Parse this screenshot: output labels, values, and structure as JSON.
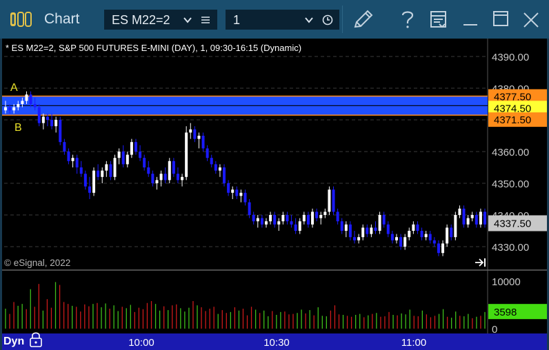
{
  "window": {
    "title": "Chart",
    "symbol": "ES M22=2",
    "interval": "1"
  },
  "chart_header": "* ES M22=2, S&P 500 FUTURES E-MINI (DAY), 1, 09:30-16:15 (Dynamic)",
  "copyright": "© eSignal, 2022",
  "annotations": {
    "top": "A",
    "bottom": "B"
  },
  "bottom_bar": {
    "mode": "Dyn"
  },
  "colors": {
    "titlebar": "#1a4e6e",
    "up_candle": "#ffffff",
    "down_candle": "#1a1aff",
    "band": "#1f4fff",
    "price_flag_orange": "#ff8c1a",
    "price_flag_yellow": "#ffff33",
    "volume_flag_green": "#44dd11",
    "last_price_flag": "#c8c8c8"
  },
  "chart_data": [
    {
      "type": "candlestick",
      "x_ticks": [
        "10:00",
        "10:30",
        "11:00"
      ],
      "y_ticks": [
        "4330.00",
        "4340.00",
        "4350.00",
        "4360.00",
        "4370.00",
        "4380.00",
        "4390.00"
      ],
      "ylim": [
        4326,
        4394
      ],
      "price_flags": [
        "4377.50",
        "4374.50",
        "4371.50"
      ],
      "last_price": "4337.50",
      "band": {
        "top": 4377.5,
        "bottom": 4371.5,
        "mid": 4374.5
      },
      "candles": [
        [
          4373,
          4376,
          4372,
          4374
        ],
        [
          4374,
          4375,
          4372,
          4373
        ],
        [
          4373,
          4375,
          4372,
          4374
        ],
        [
          4374,
          4376,
          4373,
          4375
        ],
        [
          4375,
          4377,
          4374,
          4376
        ],
        [
          4376,
          4379,
          4375,
          4378
        ],
        [
          4378,
          4379,
          4374,
          4375
        ],
        [
          4375,
          4377,
          4373,
          4374
        ],
        [
          4374,
          4375,
          4368,
          4369
        ],
        [
          4369,
          4372,
          4367,
          4371
        ],
        [
          4371,
          4372,
          4368,
          4370
        ],
        [
          4370,
          4372,
          4367,
          4368
        ],
        [
          4368,
          4371,
          4366,
          4370
        ],
        [
          4370,
          4371,
          4362,
          4363
        ],
        [
          4363,
          4364,
          4359,
          4360
        ],
        [
          4360,
          4361,
          4356,
          4357
        ],
        [
          4357,
          4359,
          4355,
          4358
        ],
        [
          4358,
          4359,
          4353,
          4355
        ],
        [
          4355,
          4357,
          4352,
          4353
        ],
        [
          4353,
          4354,
          4348,
          4349
        ],
        [
          4349,
          4352,
          4345,
          4347
        ],
        [
          4347,
          4355,
          4346,
          4354
        ],
        [
          4354,
          4356,
          4351,
          4352
        ],
        [
          4352,
          4355,
          4350,
          4354
        ],
        [
          4354,
          4357,
          4352,
          4356
        ],
        [
          4356,
          4357,
          4351,
          4352
        ],
        [
          4352,
          4359,
          4351,
          4358
        ],
        [
          4358,
          4361,
          4356,
          4360
        ],
        [
          4360,
          4362,
          4355,
          4356
        ],
        [
          4356,
          4360,
          4355,
          4359
        ],
        [
          4359,
          4364,
          4358,
          4363
        ],
        [
          4363,
          4364,
          4359,
          4360
        ],
        [
          4360,
          4362,
          4357,
          4358
        ],
        [
          4358,
          4359,
          4354,
          4355
        ],
        [
          4355,
          4357,
          4352,
          4353
        ],
        [
          4353,
          4354,
          4349,
          4350
        ],
        [
          4350,
          4352,
          4348,
          4351
        ],
        [
          4351,
          4354,
          4349,
          4353
        ],
        [
          4353,
          4355,
          4350,
          4351
        ],
        [
          4351,
          4358,
          4350,
          4357
        ],
        [
          4357,
          4358,
          4352,
          4353
        ],
        [
          4353,
          4355,
          4350,
          4351
        ],
        [
          4351,
          4353,
          4349,
          4352
        ],
        [
          4352,
          4368,
          4351,
          4366
        ],
        [
          4366,
          4369,
          4364,
          4367
        ],
        [
          4367,
          4368,
          4363,
          4364
        ],
        [
          4364,
          4366,
          4361,
          4365
        ],
        [
          4365,
          4366,
          4360,
          4361
        ],
        [
          4361,
          4362,
          4357,
          4358
        ],
        [
          4358,
          4359,
          4355,
          4356
        ],
        [
          4356,
          4357,
          4353,
          4354
        ],
        [
          4354,
          4356,
          4352,
          4355
        ],
        [
          4355,
          4356,
          4349,
          4350
        ],
        [
          4350,
          4351,
          4346,
          4347
        ],
        [
          4347,
          4349,
          4345,
          4348
        ],
        [
          4348,
          4349,
          4345,
          4346
        ],
        [
          4346,
          4348,
          4344,
          4347
        ],
        [
          4347,
          4348,
          4343,
          4344
        ],
        [
          4344,
          4345,
          4339,
          4340
        ],
        [
          4340,
          4341,
          4337,
          4338
        ],
        [
          4338,
          4340,
          4336,
          4339
        ],
        [
          4339,
          4340,
          4336,
          4337
        ],
        [
          4337,
          4339,
          4336,
          4338
        ],
        [
          4338,
          4341,
          4337,
          4340
        ],
        [
          4340,
          4341,
          4336,
          4337
        ],
        [
          4337,
          4339,
          4335,
          4338
        ],
        [
          4338,
          4341,
          4337,
          4340
        ],
        [
          4340,
          4341,
          4337,
          4338
        ],
        [
          4338,
          4340,
          4336,
          4337
        ],
        [
          4337,
          4339,
          4334,
          4335
        ],
        [
          4335,
          4339,
          4334,
          4338
        ],
        [
          4338,
          4341,
          4337,
          4340
        ],
        [
          4340,
          4341,
          4336,
          4337
        ],
        [
          4337,
          4342,
          4336,
          4341
        ],
        [
          4341,
          4342,
          4338,
          4339
        ],
        [
          4339,
          4341,
          4337,
          4340
        ],
        [
          4340,
          4342,
          4339,
          4341
        ],
        [
          4341,
          4349,
          4340,
          4348
        ],
        [
          4348,
          4349,
          4340,
          4341
        ],
        [
          4341,
          4342,
          4337,
          4338
        ],
        [
          4338,
          4339,
          4334,
          4335
        ],
        [
          4335,
          4338,
          4333,
          4337
        ],
        [
          4337,
          4338,
          4332,
          4333
        ],
        [
          4333,
          4335,
          4331,
          4332
        ],
        [
          4332,
          4334,
          4331,
          4333
        ],
        [
          4333,
          4337,
          4332,
          4336
        ],
        [
          4336,
          4337,
          4333,
          4334
        ],
        [
          4334,
          4337,
          4333,
          4336
        ],
        [
          4336,
          4338,
          4334,
          4335
        ],
        [
          4335,
          4341,
          4334,
          4340
        ],
        [
          4340,
          4341,
          4336,
          4337
        ],
        [
          4337,
          4338,
          4333,
          4334
        ],
        [
          4334,
          4335,
          4331,
          4332
        ],
        [
          4332,
          4334,
          4331,
          4333
        ],
        [
          4333,
          4334,
          4329,
          4330
        ],
        [
          4330,
          4334,
          4329,
          4333
        ],
        [
          4333,
          4336,
          4332,
          4335
        ],
        [
          4335,
          4338,
          4334,
          4337
        ],
        [
          4337,
          4338,
          4334,
          4335
        ],
        [
          4335,
          4336,
          4332,
          4333
        ],
        [
          4333,
          4335,
          4332,
          4334
        ],
        [
          4334,
          4335,
          4331,
          4332
        ],
        [
          4332,
          4333,
          4330,
          4331
        ],
        [
          4331,
          4332,
          4327,
          4328
        ],
        [
          4328,
          4332,
          4327,
          4331
        ],
        [
          4331,
          4337,
          4330,
          4336
        ],
        [
          4336,
          4337,
          4332,
          4333
        ],
        [
          4333,
          4341,
          4332,
          4340
        ],
        [
          4340,
          4343,
          4339,
          4342
        ],
        [
          4342,
          4343,
          4336,
          4337
        ],
        [
          4337,
          4340,
          4336,
          4339
        ],
        [
          4339,
          4341,
          4338,
          4340
        ],
        [
          4340,
          4341,
          4336,
          4337
        ],
        [
          4337,
          4342,
          4336,
          4341
        ],
        [
          4341,
          4342,
          4336,
          4337
        ]
      ]
    },
    {
      "type": "bar",
      "name": "volume",
      "y_ticks": [
        "0",
        "10000"
      ],
      "ylim": [
        0,
        10000
      ],
      "last_value": "3598",
      "values": [
        4200,
        3100,
        5600,
        4800,
        5200,
        4100,
        8300,
        4600,
        9400,
        3800,
        6200,
        4400,
        9800,
        9200,
        5600,
        5200,
        4800,
        4600,
        3600,
        5100,
        4700,
        5200,
        5400,
        4500,
        5300,
        4200,
        4900,
        3700,
        4600,
        4300,
        5000,
        3500,
        4400,
        4100,
        5400,
        5800,
        5200,
        3800,
        4700,
        3900,
        4900,
        5100,
        4300,
        3600,
        4400,
        5800,
        4900,
        4500,
        3700,
        4200,
        4600,
        3100,
        3900,
        3300,
        3500,
        4500,
        3800,
        4200,
        2800,
        4600,
        4000,
        3300,
        3800,
        2600,
        3700,
        2900,
        3500,
        3600,
        3000,
        3100,
        3300,
        4000,
        3200,
        3900,
        2800,
        4500,
        2700,
        2600,
        3800,
        4900,
        3000,
        2900,
        2700,
        2500,
        2900,
        3100,
        2400,
        2800,
        3100,
        3300,
        2500,
        2600,
        3500,
        2900,
        2800,
        3200,
        3000,
        4000,
        2700,
        2600,
        3800,
        3000,
        2400,
        2700,
        3100,
        4100,
        2500,
        2300,
        3600,
        2700,
        2600,
        3100,
        2200,
        2500,
        2700,
        3500
      ],
      "up": [
        1,
        0,
        0,
        1,
        1,
        0,
        1,
        0,
        0,
        1,
        0,
        0,
        1,
        0,
        0,
        0,
        1,
        0,
        0,
        0,
        0,
        1,
        0,
        1,
        1,
        0,
        1,
        1,
        0,
        1,
        1,
        0,
        0,
        0,
        0,
        0,
        1,
        1,
        0,
        1,
        0,
        0,
        1,
        1,
        1,
        0,
        1,
        0,
        0,
        0,
        0,
        1,
        0,
        0,
        1,
        0,
        1,
        0,
        0,
        0,
        1,
        0,
        1,
        1,
        0,
        1,
        1,
        0,
        0,
        0,
        1,
        1,
        0,
        1,
        0,
        1,
        1,
        1,
        0,
        0,
        0,
        1,
        0,
        0,
        1,
        1,
        0,
        1,
        0,
        1,
        0,
        0,
        0,
        1,
        0,
        1,
        1,
        1,
        0,
        0,
        1,
        0,
        0,
        0,
        1,
        1,
        0,
        1,
        1,
        0,
        1,
        1,
        0,
        1,
        0,
        1
      ]
    }
  ]
}
